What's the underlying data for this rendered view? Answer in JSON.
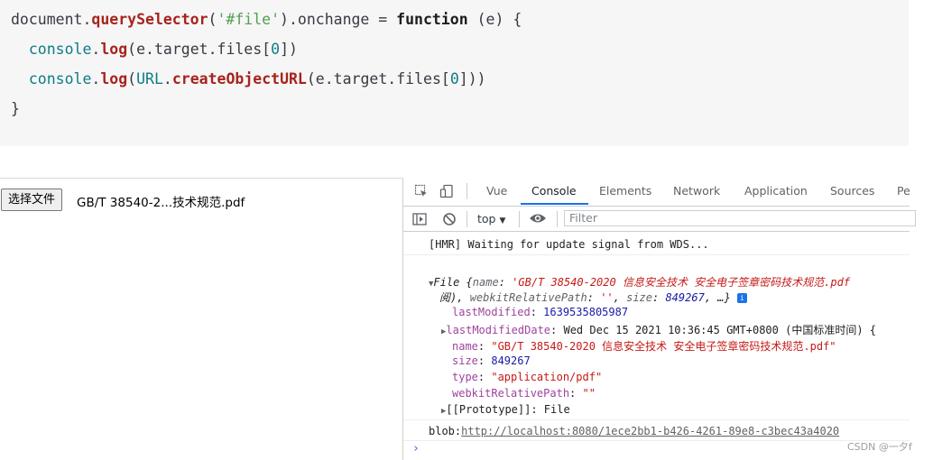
{
  "code": {
    "line1": {
      "p1": "document.",
      "p2": "querySelector",
      "p3": "(",
      "p4": "'#file'",
      "p5": ").onchange = ",
      "p6": "function",
      "p7": " (e) {"
    },
    "line2": {
      "p1": "  ",
      "p2": "console",
      "p3": ".",
      "p4": "log",
      "p5": "(e.target.files[",
      "p6": "0",
      "p7": "])"
    },
    "line3": {
      "p1": "  ",
      "p2": "console",
      "p3": ".",
      "p4": "log",
      "p5": "(",
      "p6": "URL",
      "p7": ".",
      "p8": "createObjectURL",
      "p9": "(e.target.files[",
      "p10": "0",
      "p11": "]))"
    },
    "line4": "}"
  },
  "page": {
    "file_button": "选择文件",
    "file_name": "GB/T 38540-2...技术规范.pdf"
  },
  "devtools": {
    "tabs": [
      "Vue",
      "Console",
      "Elements",
      "Network",
      "Application",
      "Sources",
      "Pe"
    ],
    "active_tab": "Console",
    "context": "top",
    "context_arrow": "▼",
    "filter_placeholder": "Filter",
    "hmr": "[HMR] Waiting for update signal from WDS...",
    "file_obj": {
      "head1": "File {",
      "name_key": "name",
      "name_val": "'GB/T 38540-2020 信息安全技术 安全电子签章密码技术规范.pdf",
      "line2a": "阅), ",
      "wrp_key": "webkitRelativePath",
      "wrp_val": "''",
      "size_key": "size",
      "size_val": "849267",
      "line2b": ", …}",
      "info": "i"
    },
    "props": {
      "lastModified_key": "lastModified",
      "lastModified_val": "1639535805987",
      "lastModifiedDate_key": "lastModifiedDate",
      "lastModifiedDate_val": "Wed Dec 15 2021 10:36:45 GMT+0800 (中国标准时间) {",
      "name_key": "name",
      "name_val": "\"GB/T 38540-2020 信息安全技术 安全电子签章密码技术规范.pdf\"",
      "size_key": "size",
      "size_val": "849267",
      "type_key": "type",
      "type_val": "\"application/pdf\"",
      "wrp_key": "webkitRelativePath",
      "wrp_val": "\"\"",
      "proto": "[[Prototype]]: File"
    },
    "blob_prefix": "blob:",
    "blob_url": "http://localhost:8080/1ece2bb1-b426-4261-89e8-c3bec43a4020",
    "prompt": "›"
  },
  "watermark": "CSDN @一夕f"
}
